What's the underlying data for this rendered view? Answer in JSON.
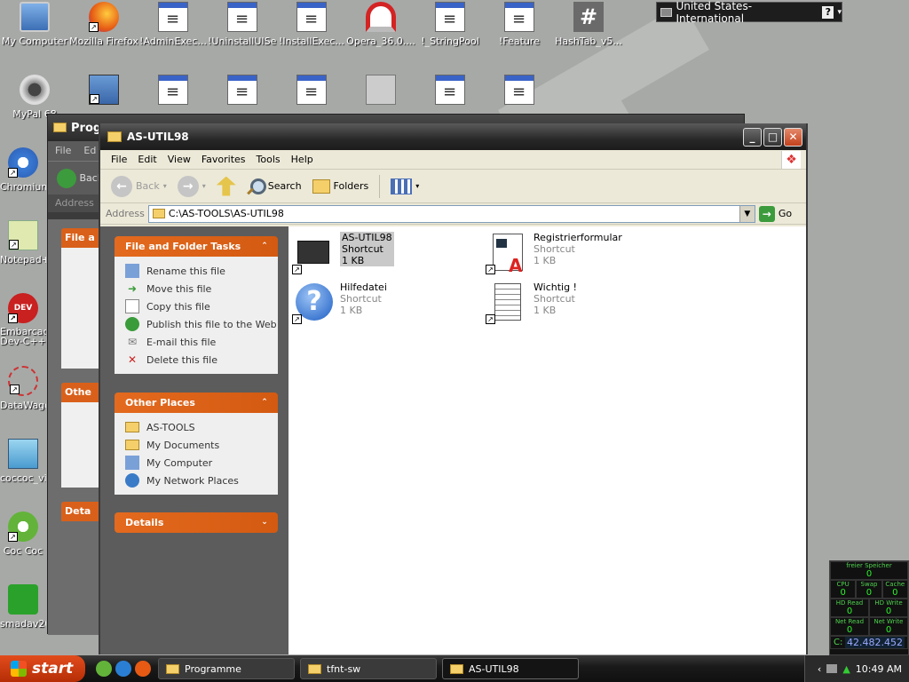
{
  "desktop": {
    "icons": [
      {
        "label": "My Computer"
      },
      {
        "label": "Mozilla Firefox"
      },
      {
        "label": "!AdminExec..."
      },
      {
        "label": "!UninstallUISeq..."
      },
      {
        "label": "!InstallExec..."
      },
      {
        "label": "Opera_36.0...."
      },
      {
        "label": "!_StringPool"
      },
      {
        "label": "!Feature"
      },
      {
        "label": "HashTab_v5..."
      },
      {
        "label": "MyPal 68"
      },
      {
        "label": "Chromium"
      },
      {
        "label": "Notepad++"
      },
      {
        "label": "Embarcadero Dev-C++"
      },
      {
        "label": "DataWago"
      },
      {
        "label": "coccoc_vi"
      },
      {
        "label": "Coc Coc"
      },
      {
        "label": "smadav20"
      }
    ]
  },
  "langbar": {
    "language": "United States-International",
    "help": "?"
  },
  "bgwindow": {
    "title": "Programme",
    "menu_file": "File",
    "menu_edit": "Ed",
    "back": "Back",
    "address": "Address",
    "task1": "File a",
    "task2": "Othe",
    "task3": "Deta"
  },
  "window": {
    "title": "AS-UTIL98",
    "menu": [
      "File",
      "Edit",
      "View",
      "Favorites",
      "Tools",
      "Help"
    ],
    "toolbar": {
      "back": "Back",
      "search": "Search",
      "folders": "Folders"
    },
    "address": {
      "label": "Address",
      "value": "C:\\AS-TOOLS\\AS-UTIL98",
      "go": "Go"
    },
    "tasks": {
      "title": "File and Folder Tasks",
      "items": [
        "Rename this file",
        "Move this file",
        "Copy this file",
        "Publish this file to the Web",
        "E-mail this file",
        "Delete this file"
      ]
    },
    "other_places": {
      "title": "Other Places",
      "items": [
        "AS-TOOLS",
        "My Documents",
        "My Computer",
        "My Network Places"
      ]
    },
    "details": {
      "title": "Details"
    },
    "files": [
      {
        "name": "AS-UTIL98",
        "type": "Shortcut",
        "size": "1 KB"
      },
      {
        "name": "Registrierformular",
        "type": "Shortcut",
        "size": "1 KB"
      },
      {
        "name": "Hilfedatei",
        "type": "Shortcut",
        "size": "1 KB"
      },
      {
        "name": "Wichtig !",
        "type": "Shortcut",
        "size": "1 KB"
      }
    ]
  },
  "taskbar": {
    "start": "start",
    "buttons": [
      "Programme",
      "tfnt-sw",
      "AS-UTIL98"
    ],
    "clock": "10:49 AM"
  },
  "resmon": {
    "title": "freier Speicher",
    "free": "0",
    "cpu_label": "CPU",
    "cpu": "0",
    "swap_label": "Swap",
    "swap": "0",
    "cache_label": "Cache",
    "cache": "0",
    "hdread_label": "HD Read",
    "hdread": "0",
    "hdwrite_label": "HD Write",
    "hdwrite": "0",
    "netread_label": "Net Read",
    "netread": "0",
    "netwrite_label": "Net Write",
    "netwrite": "0",
    "drive": "C:",
    "drive_value": "42.482.452"
  }
}
